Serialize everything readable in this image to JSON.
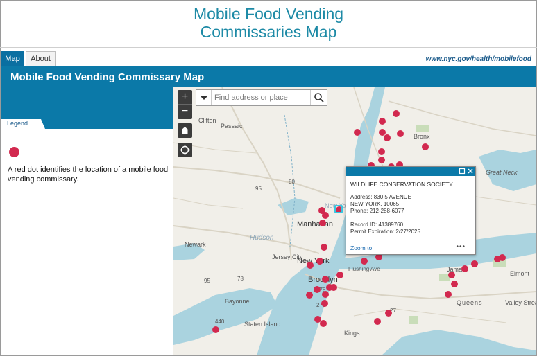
{
  "header": {
    "title_line1": "Mobile Food Vending",
    "title_line2": "Commissaries Map"
  },
  "tabs": [
    {
      "label": "Map",
      "active": true
    },
    {
      "label": "About",
      "active": false
    }
  ],
  "site_link": "www.nyc.gov/health/mobilefood",
  "app_title": "Mobile Food Vending Commissary Map",
  "legend": {
    "tab_label": "Legend",
    "dot_color": "#d2294f",
    "description": "A red dot identifies the location of a mobile food vending commissary."
  },
  "search": {
    "placeholder": "Find address or place"
  },
  "map_controls": {
    "zoom_in": "+",
    "zoom_out": "−"
  },
  "map_labels": {
    "clifton": "Clifton",
    "passaic": "Passaic",
    "bronx": "Bronx",
    "great_neck": "Great Neck",
    "manhattan": "Manhattan",
    "new_york": "New York",
    "new_york_faint": "New York",
    "newark": "Newark",
    "hudson": "Hudson",
    "jersey_city": "Jersey City",
    "brooklyn": "Brooklyn",
    "bayonne": "Bayonne",
    "staten_island": "Staten Island",
    "kings": "Kings",
    "queens": "Queens",
    "jamaica": "Jama",
    "elmont": "Elmont",
    "valley_stream": "Valley Strea",
    "flushing_ave": "Flushing Ave",
    "highway_95a": "95",
    "highway_95b": "95",
    "highway_80": "80",
    "highway_78": "78",
    "highway_278a": "278",
    "highway_278b": "278",
    "highway_27": "27",
    "highway_440": "440"
  },
  "popup": {
    "name": "WILDLIFE CONSERVATION SOCIETY",
    "address": "Address: 830 5 AVENUE",
    "city": "NEW YORK, 10065",
    "phone": "Phone: 212-288-6077",
    "record_id": "Record ID: 41389760",
    "permit": "Permit Expiration: 2/27/2025",
    "zoom_to": "Zoom to",
    "more": "•••"
  }
}
